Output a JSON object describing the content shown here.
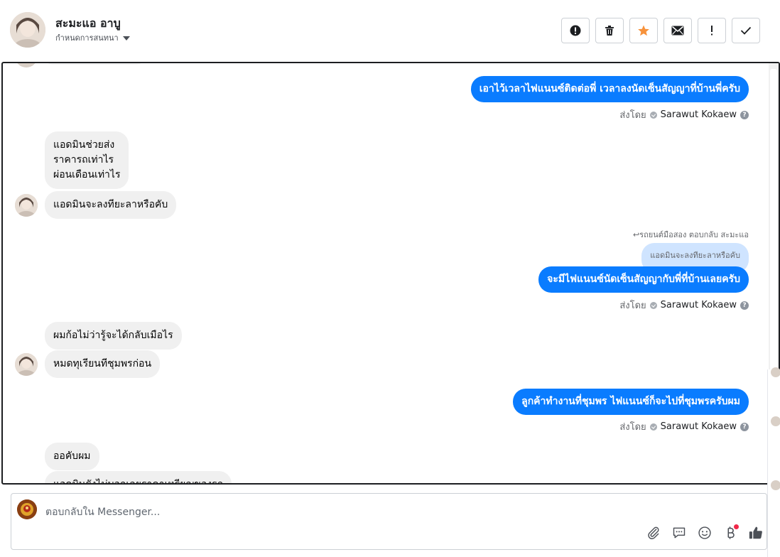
{
  "header": {
    "contact_name": "สะมะแอ อาบู",
    "label_menu": "กำหนดการสนทนา"
  },
  "toolbar": {
    "buttons": [
      {
        "name": "mark-spam",
        "icon": "alert-circle-icon"
      },
      {
        "name": "delete",
        "icon": "trash-icon"
      },
      {
        "name": "star",
        "icon": "star-icon",
        "color": "#f7923b"
      },
      {
        "name": "mark-unread",
        "icon": "envelope-icon"
      },
      {
        "name": "follow-up",
        "icon": "exclamation-icon"
      },
      {
        "name": "mark-done",
        "icon": "check-icon"
      }
    ]
  },
  "messages": {
    "out_1": "เอาไว้เวลาไฟแนนซ์ติดต่อพี่ เวลาลงนัดเซ็นสัญญาที่บ้านพี่ครับ",
    "in_1": "แอดมินช่วยส่ง\nราคารถเท่าไร\nผ่อนเดือนเท่าไร",
    "in_2": "แอดมินจะลงทียะลาหรือคับ",
    "reply_note": "↩รถยนต์มือสอง ตอบกลับ สะมะแอ",
    "quoted": "แอดมินจะลงทียะลาหรือคับ",
    "out_2": "จะมีไฟแนนซ์นัดเซ็นสัญญากับพี่ที่บ้านเลยครับ",
    "in_3": "ผมก้อไม่ว่ารู้จะได้กลับเมือไร",
    "in_4": "หมดทุเรียนทีชุมพรก่อน",
    "out_3": "ลูกค้าทำงานที่ชุมพร ไฟแนนซ์ก็จะไปที่ชุมพรครับผม",
    "in_5": "ออคับผม",
    "in_6": "แอดมินยังไม่บอกเลยราคาเหรียญของรถ"
  },
  "sent_by": {
    "prefix": "ส่งโดย",
    "agent": "Sarawut Kokaew",
    "help": "?"
  },
  "composer": {
    "placeholder": "ตอบกลับใน Messenger...",
    "tools": [
      "paperclip-icon",
      "saved-replies-icon",
      "emoji-icon",
      "baht-icon",
      "thumbs-up-icon"
    ],
    "thumbs_color": "#4b4f56"
  },
  "colors": {
    "outgoing": "#0a7cff",
    "incoming": "#f0f0f0"
  }
}
